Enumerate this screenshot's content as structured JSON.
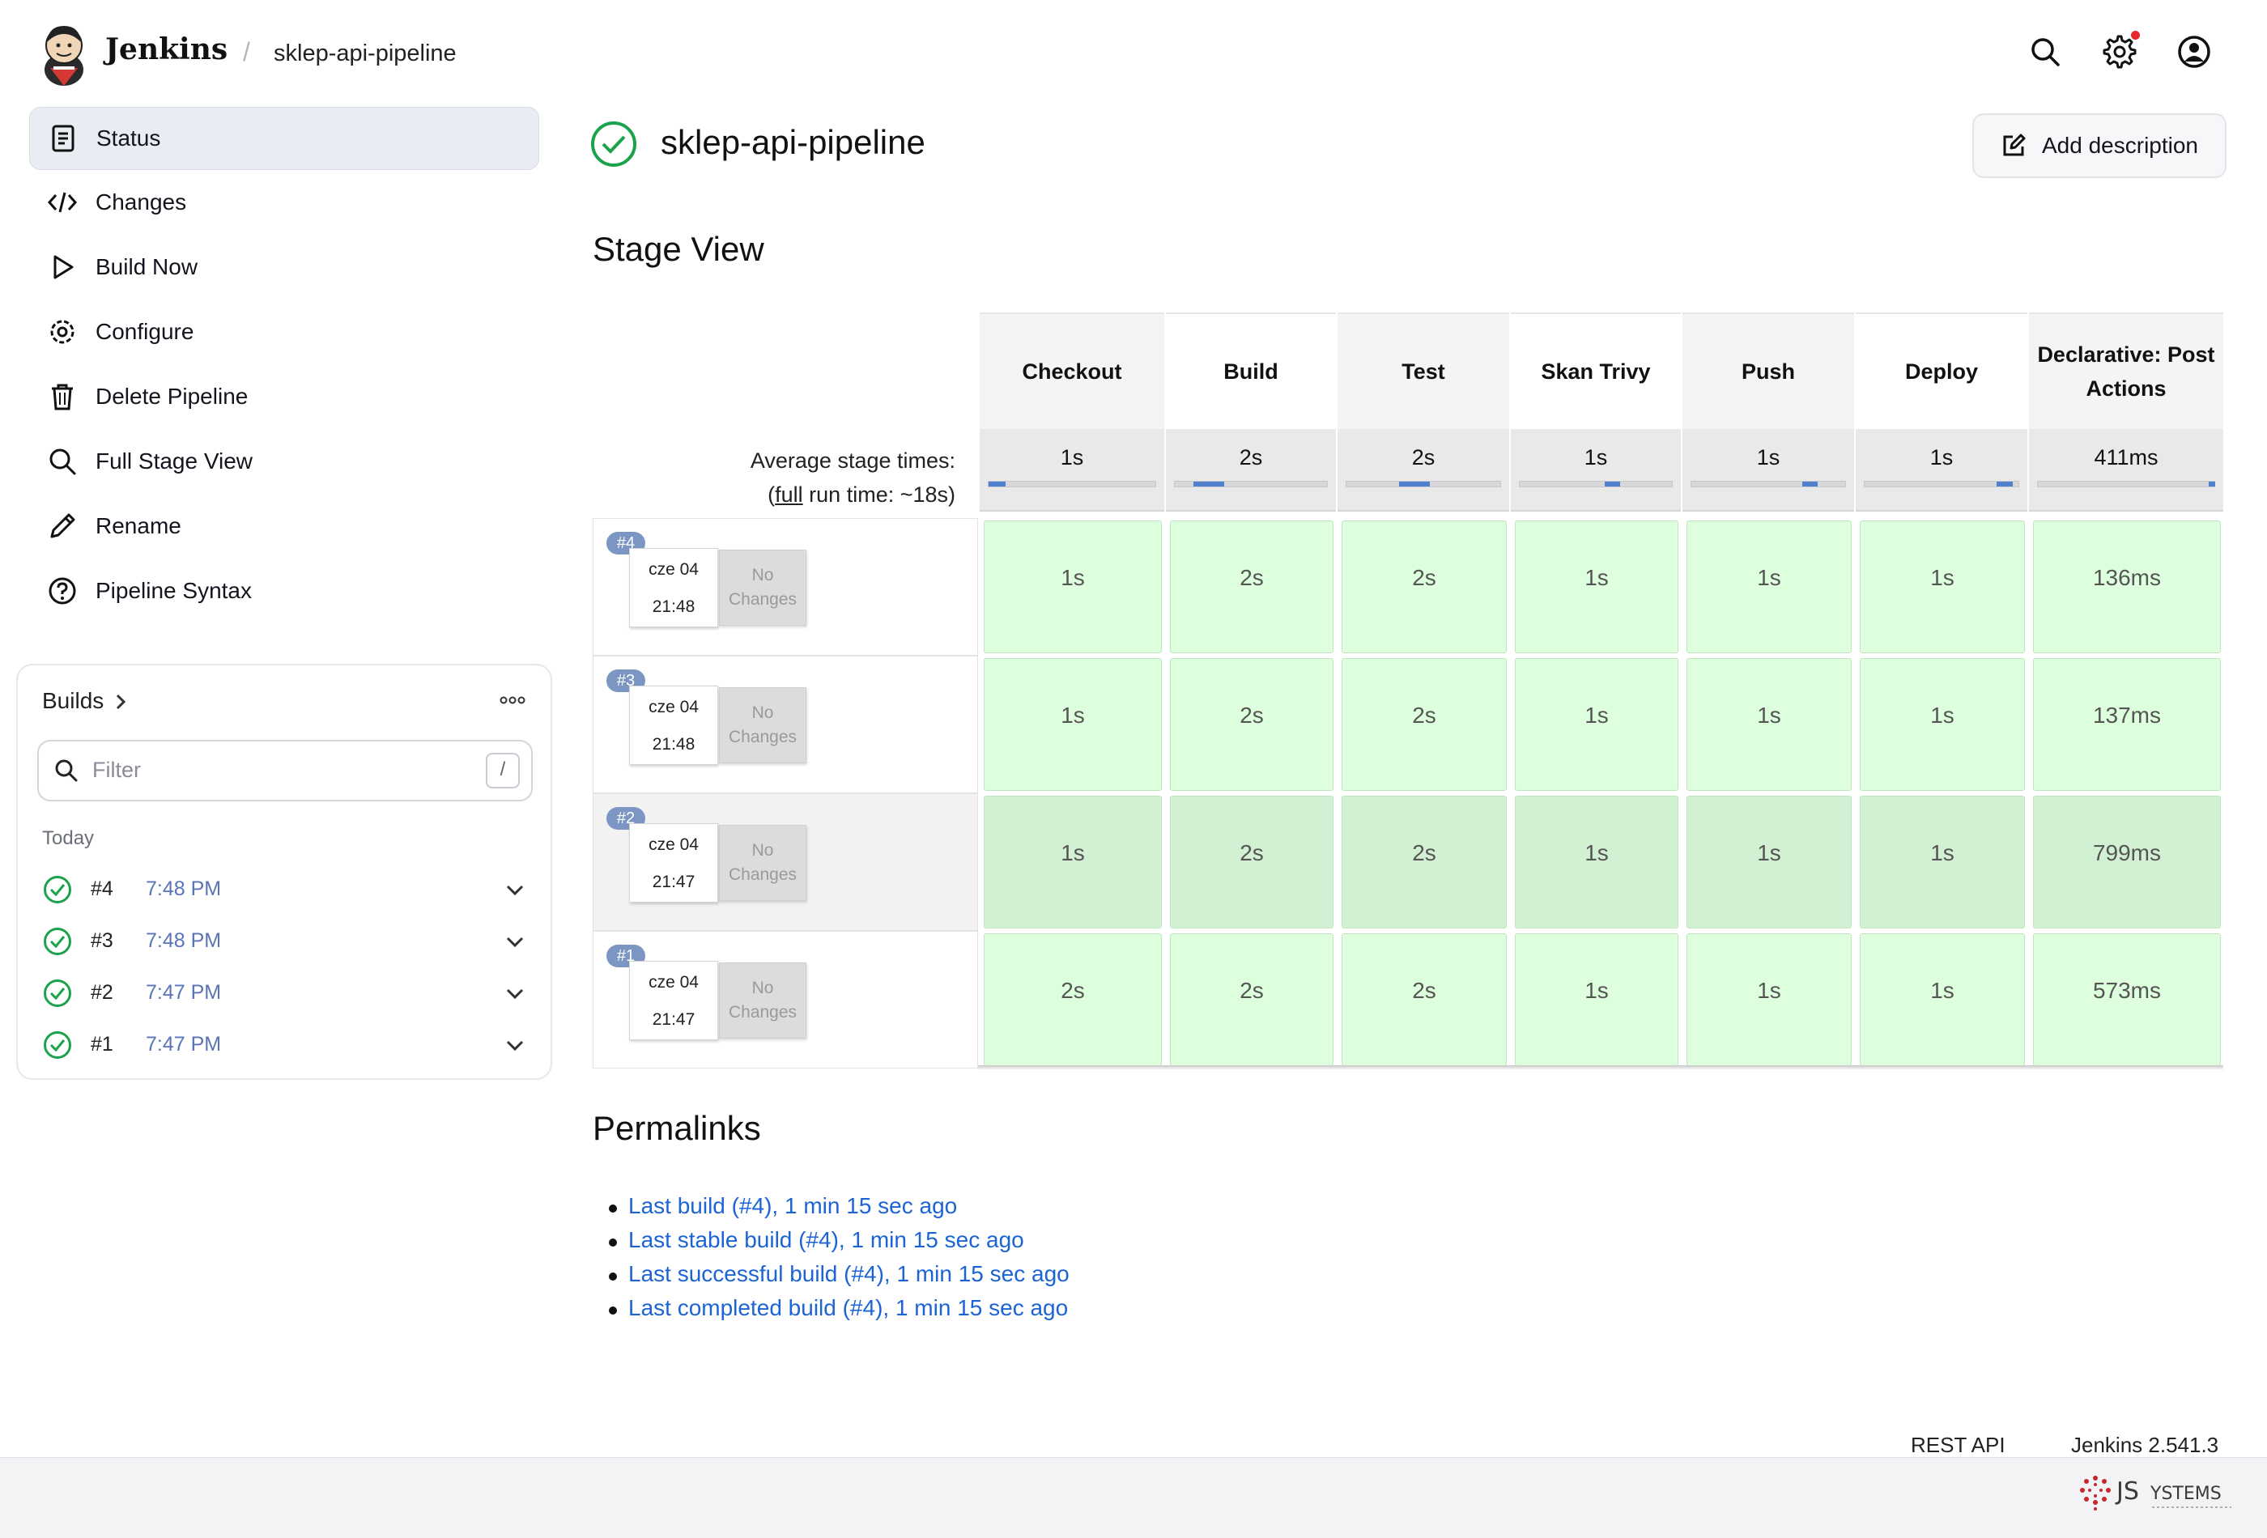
{
  "header": {
    "brand": "Jenkins",
    "breadcrumb_separator": "/",
    "job_name": "sklep-api-pipeline",
    "icons": [
      "search-icon",
      "gear-icon",
      "user-icon"
    ]
  },
  "sidebar": {
    "items": [
      {
        "label": "Status",
        "icon": "document-icon",
        "active": true
      },
      {
        "label": "Changes",
        "icon": "code-icon"
      },
      {
        "label": "Build Now",
        "icon": "play-icon"
      },
      {
        "label": "Configure",
        "icon": "gear-icon"
      },
      {
        "label": "Delete Pipeline",
        "icon": "trash-icon"
      },
      {
        "label": "Full Stage View",
        "icon": "search-icon"
      },
      {
        "label": "Rename",
        "icon": "pencil-icon"
      },
      {
        "label": "Pipeline Syntax",
        "icon": "help-icon"
      }
    ],
    "builds": {
      "title": "Builds",
      "filter_placeholder": "Filter",
      "filter_shortcut": "/",
      "group": "Today",
      "items": [
        {
          "number": "#4",
          "time": "7:48 PM"
        },
        {
          "number": "#3",
          "time": "7:48 PM"
        },
        {
          "number": "#2",
          "time": "7:47 PM"
        },
        {
          "number": "#1",
          "time": "7:47 PM"
        }
      ]
    }
  },
  "main": {
    "title": "sklep-api-pipeline",
    "add_description": "Add description",
    "stage_view_heading": "Stage View",
    "permalinks_heading": "Permalinks",
    "permalinks": [
      "Last build (#4), 1 min 15 sec ago",
      "Last stable build (#4), 1 min 15 sec ago",
      "Last successful build (#4), 1 min 15 sec ago",
      "Last completed build (#4), 1 min 15 sec ago"
    ]
  },
  "stage_view": {
    "avg_label_1": "Average stage times:",
    "avg_label_2_prefix": "(",
    "avg_label_2_link": "full",
    "avg_label_2_suffix": " run time: ~18s)",
    "stages": [
      {
        "name": "Checkout",
        "avg": "1s",
        "avg_fraction": 0.06
      },
      {
        "name": "Build",
        "avg": "2s",
        "avg_fraction": 0.12
      },
      {
        "name": "Test",
        "avg": "2s",
        "avg_fraction": 0.12
      },
      {
        "name": "Skan Trivy",
        "avg": "1s",
        "avg_fraction": 0.06
      },
      {
        "name": "Push",
        "avg": "1s",
        "avg_fraction": 0.06
      },
      {
        "name": "Deploy",
        "avg": "1s",
        "avg_fraction": 0.06
      },
      {
        "name": "Declarative: Post Actions",
        "avg": "411ms",
        "avg_fraction": 0.02
      }
    ],
    "runs": [
      {
        "badge": "#4",
        "date": "cze 04",
        "time": "21:48",
        "changes": "No Changes",
        "cells": [
          "1s",
          "2s",
          "2s",
          "1s",
          "1s",
          "1s",
          "136ms"
        ]
      },
      {
        "badge": "#3",
        "date": "cze 04",
        "time": "21:48",
        "changes": "No Changes",
        "cells": [
          "1s",
          "2s",
          "2s",
          "1s",
          "1s",
          "1s",
          "137ms"
        ]
      },
      {
        "badge": "#2",
        "date": "cze 04",
        "time": "21:47",
        "changes": "No Changes",
        "cells": [
          "1s",
          "2s",
          "2s",
          "1s",
          "1s",
          "1s",
          "799ms"
        ]
      },
      {
        "badge": "#1",
        "date": "cze 04",
        "time": "21:47",
        "changes": "No Changes",
        "cells": [
          "2s",
          "2s",
          "2s",
          "1s",
          "1s",
          "1s",
          "573ms"
        ]
      }
    ]
  },
  "footer": {
    "rest_api": "REST API",
    "version": "Jenkins 2.541.3",
    "partner_logo": "JSystems"
  },
  "colors": {
    "success": "#1aa34a",
    "link": "#1c63d6",
    "stage_success": "#deffde",
    "badge": "#7c96c4",
    "avg_bar": "#4f7fcf"
  }
}
